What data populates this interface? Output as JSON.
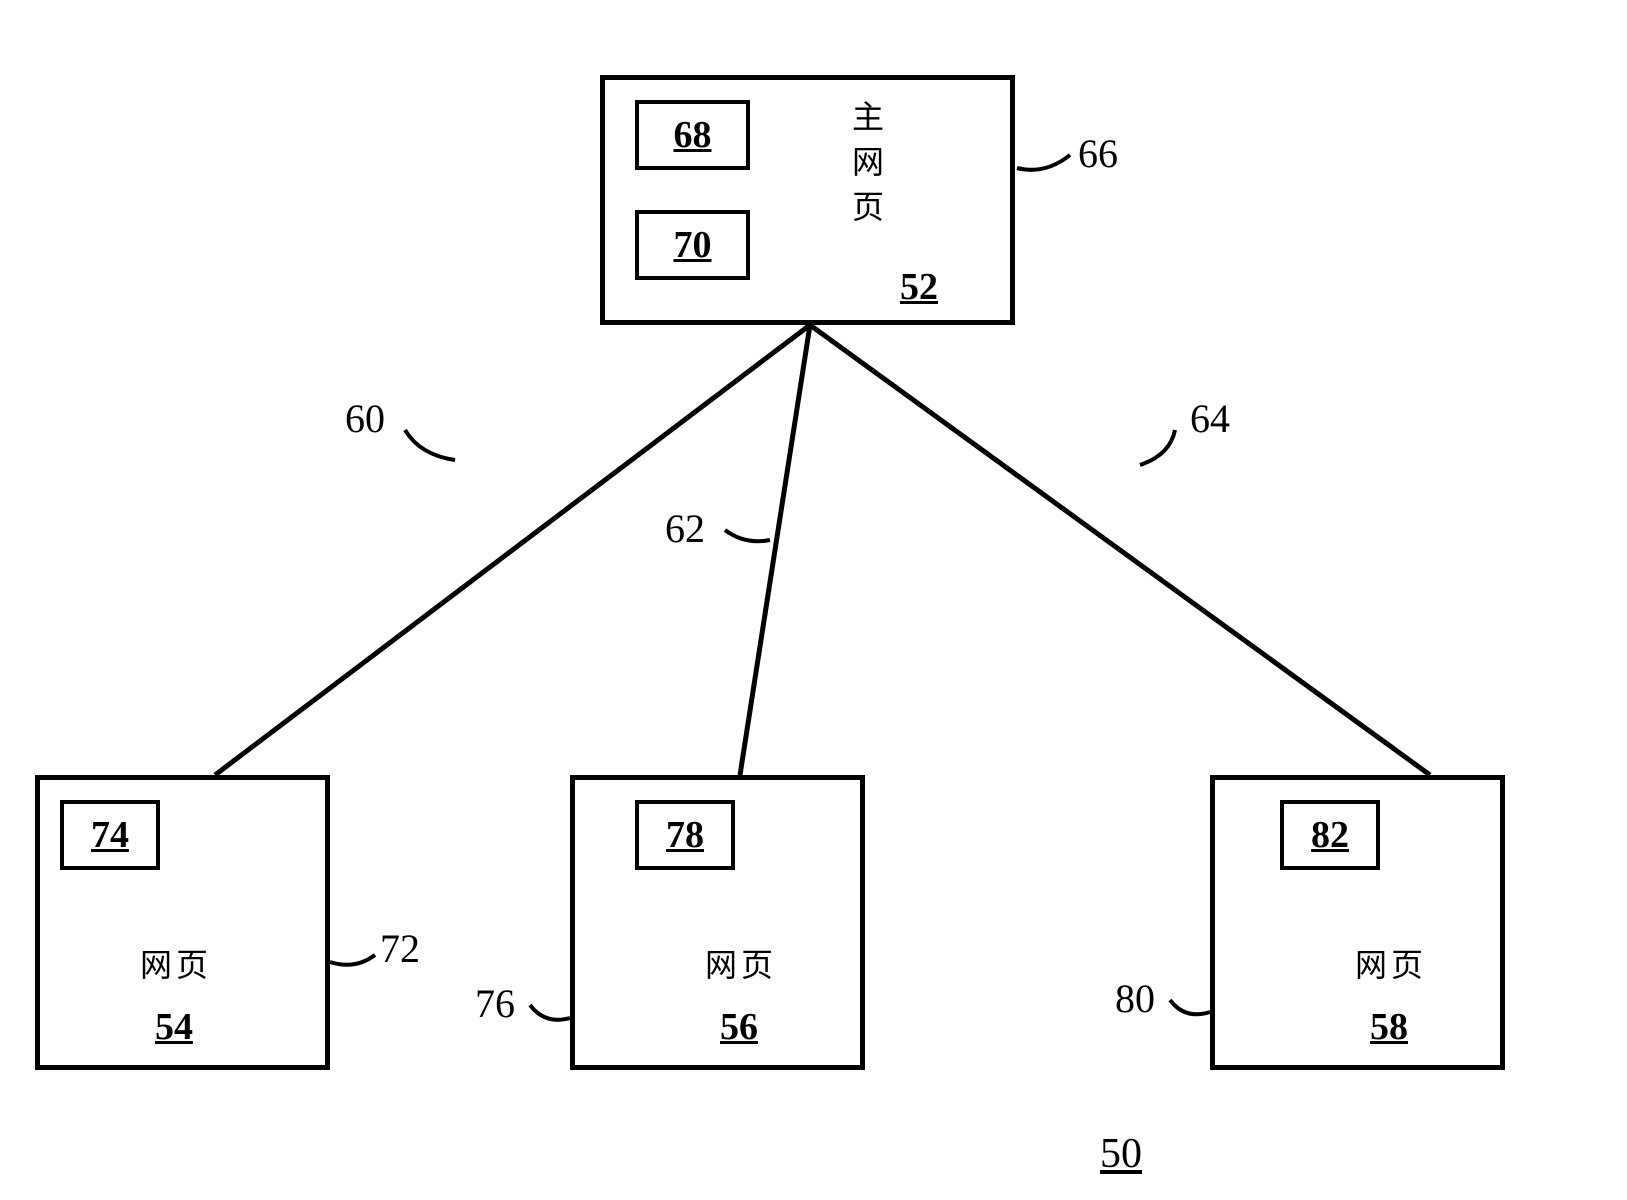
{
  "figure_ref": "50",
  "main_node": {
    "label_line1": "主",
    "label_line2": "网",
    "label_line3": "页",
    "ref": "52",
    "callout": "66",
    "inner_boxes": [
      "68",
      "70"
    ]
  },
  "child_nodes": [
    {
      "label": "网页",
      "ref": "54",
      "callout": "72",
      "inner_box": "74"
    },
    {
      "label": "网页",
      "ref": "56",
      "callout": "76",
      "inner_box": "78"
    },
    {
      "label": "网页",
      "ref": "58",
      "callout": "80",
      "inner_box": "82"
    }
  ],
  "edges": [
    {
      "callout": "60"
    },
    {
      "callout": "62"
    },
    {
      "callout": "64"
    }
  ]
}
